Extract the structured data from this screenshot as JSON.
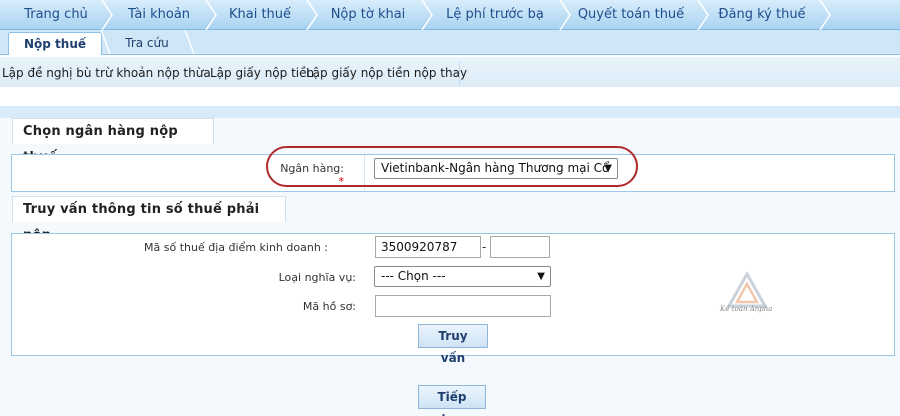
{
  "topnav": {
    "items": [
      "Trang chủ",
      "Tài khoản",
      "Khai thuế",
      "Nộp tờ khai",
      "Lệ phí trước bạ",
      "Quyết toán thuế",
      "Đăng ký thuế"
    ]
  },
  "subnav": {
    "tabs": [
      "Nộp thuế",
      "Tra cứu"
    ],
    "active_tab": "Nộp thuế"
  },
  "links": {
    "items": [
      "Lập đề nghị bù trừ khoản nộp thừa",
      "Lập giấy nộp tiền",
      "Lập giấy nộp tiền nộp thay"
    ]
  },
  "bank_section": {
    "title": "Chọn ngân hàng nộp thuế",
    "bank_label": "Ngân hàng:",
    "required_mark": "*",
    "bank_selected": "Vietinbank-Ngân hàng Thương mại Cổ"
  },
  "query_section": {
    "title": "Truy vấn thông tin số thuế phải nộp",
    "tax_code_label": "Mã số thuế địa điểm kinh doanh :",
    "tax_code_value": "3500920787",
    "tax_code_suffix_value": "",
    "obligation_label": "Loại nghĩa vụ:",
    "obligation_selected": "--- Chọn ---",
    "file_code_label": "Mã hồ sơ:",
    "file_code_value": "",
    "query_button": "Truy vấn"
  },
  "continue_button": "Tiếp tục",
  "watermark": {
    "text": "Kế toán Anpha"
  }
}
